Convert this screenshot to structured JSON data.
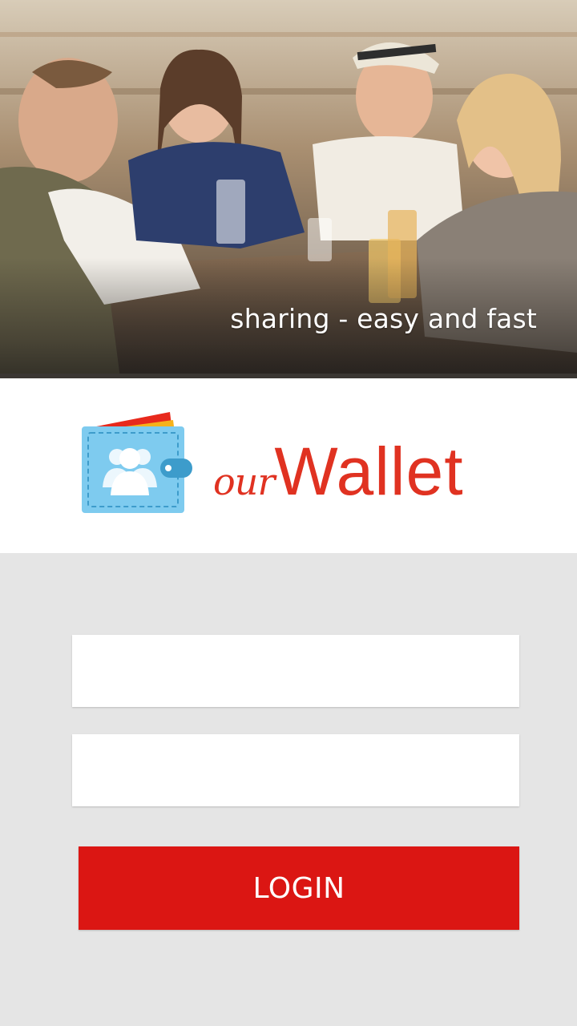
{
  "hero": {
    "tagline": "sharing - easy and fast",
    "image": "friends-at-bar-table-photo"
  },
  "brand": {
    "name_prefix": "our",
    "name_main": "Wallet",
    "logo_icon": "wallet-group-icon",
    "name_color": "#e03221"
  },
  "login_form": {
    "username": {
      "value": "",
      "placeholder": ""
    },
    "password": {
      "value": "",
      "placeholder": ""
    },
    "login_label": "LOGIN"
  },
  "colors": {
    "accent": "#db1613",
    "background": "#e5e5e5",
    "wallet_blue": "#7ecbef"
  }
}
